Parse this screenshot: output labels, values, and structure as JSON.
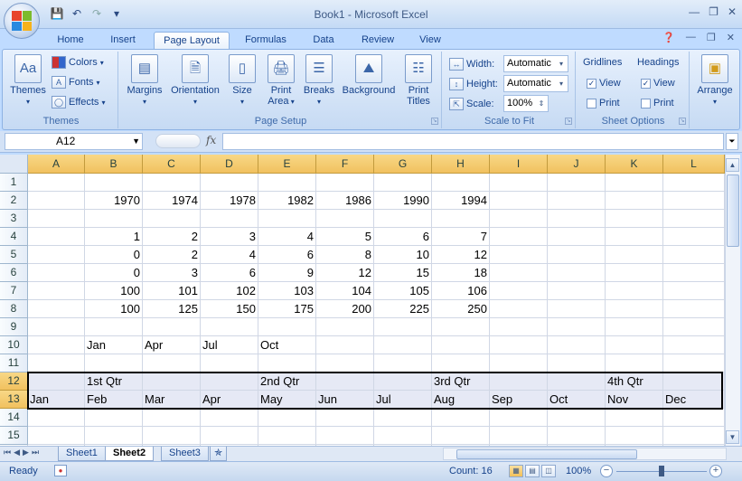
{
  "window": {
    "title": "Book1 - Microsoft Excel"
  },
  "tabs": [
    {
      "label": "Home"
    },
    {
      "label": "Insert"
    },
    {
      "label": "Page Layout"
    },
    {
      "label": "Formulas"
    },
    {
      "label": "Data"
    },
    {
      "label": "Review"
    },
    {
      "label": "View"
    }
  ],
  "active_tab": "Page Layout",
  "ribbon": {
    "themes": {
      "themes_btn": "Themes",
      "colors": "Colors",
      "fonts": "Fonts",
      "effects": "Effects",
      "label": "Themes"
    },
    "page_setup": {
      "margins": "Margins",
      "orientation": "Orientation",
      "size": "Size",
      "print_area_1": "Print",
      "print_area_2": "Area",
      "breaks": "Breaks",
      "background": "Background",
      "print_titles_1": "Print",
      "print_titles_2": "Titles",
      "label": "Page Setup"
    },
    "scale": {
      "width_label": "Width:",
      "width_value": "Automatic",
      "height_label": "Height:",
      "height_value": "Automatic",
      "scale_label": "Scale:",
      "scale_value": "100%",
      "label": "Scale to Fit"
    },
    "sheet_options": {
      "gridlines": "Gridlines",
      "headings": "Headings",
      "view": "View",
      "print": "Print",
      "label": "Sheet Options"
    },
    "arrange": {
      "label": "Arrange"
    }
  },
  "formula_bar": {
    "name_box": "A12",
    "fx": "fx",
    "content": ""
  },
  "columns": [
    "A",
    "B",
    "C",
    "D",
    "E",
    "F",
    "G",
    "H",
    "I",
    "J",
    "K",
    "L"
  ],
  "rows": [
    "1",
    "2",
    "3",
    "4",
    "5",
    "6",
    "7",
    "8",
    "9",
    "10",
    "11",
    "12",
    "13",
    "14",
    "15"
  ],
  "cells": {
    "B2": "1970",
    "C2": "1974",
    "D2": "1978",
    "E2": "1982",
    "F2": "1986",
    "G2": "1990",
    "H2": "1994",
    "B4": "1",
    "C4": "2",
    "D4": "3",
    "E4": "4",
    "F4": "5",
    "G4": "6",
    "H4": "7",
    "B5": "0",
    "C5": "2",
    "D5": "4",
    "E5": "6",
    "F5": "8",
    "G5": "10",
    "H5": "12",
    "B6": "0",
    "C6": "3",
    "D6": "6",
    "E6": "9",
    "F6": "12",
    "G6": "15",
    "H6": "18",
    "B7": "100",
    "C7": "101",
    "D7": "102",
    "E7": "103",
    "F7": "104",
    "G7": "105",
    "H7": "106",
    "B8": "100",
    "C8": "125",
    "D8": "150",
    "E8": "175",
    "F8": "200",
    "G8": "225",
    "H8": "250",
    "B10": "Jan",
    "C10": "Apr",
    "D10": "Jul",
    "E10": "Oct",
    "B12": "1st Qtr",
    "E12": "2nd Qtr",
    "H12": "3rd Qtr",
    "K12": "4th Qtr",
    "A13": "Jan",
    "B13": "Feb",
    "C13": "Mar",
    "D13": "Apr",
    "E13": "May",
    "F13": "Jun",
    "G13": "Jul",
    "H13": "Aug",
    "I13": "Sep",
    "J13": "Oct",
    "K13": "Nov",
    "L13": "Dec"
  },
  "sheets": [
    {
      "name": "Sheet1"
    },
    {
      "name": "Sheet2"
    },
    {
      "name": "Sheet3"
    }
  ],
  "active_sheet": "Sheet2",
  "status": {
    "ready": "Ready",
    "count": "Count: 16",
    "zoom": "100%"
  }
}
